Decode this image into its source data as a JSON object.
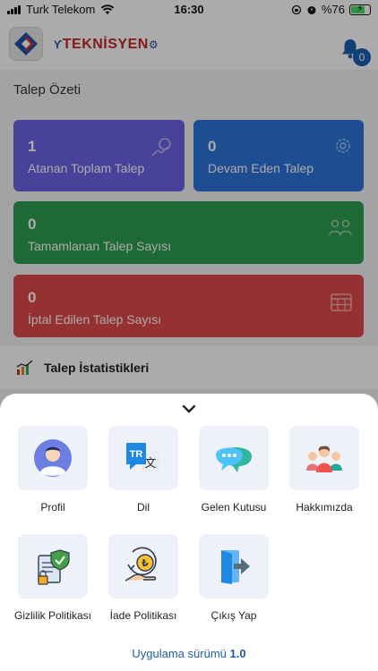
{
  "status_bar": {
    "carrier": "Turk Telekom",
    "time": "16:30",
    "battery": "%76",
    "battery_level": 0.76
  },
  "header": {
    "brand": "TEKNİSYEN",
    "notification_count": "0"
  },
  "summary": {
    "title": "Talep Özeti",
    "cards": [
      {
        "value": "1",
        "label": "Atanan Toplam Talep",
        "color": "#6c63e6"
      },
      {
        "value": "0",
        "label": "Devam Eden Talep",
        "color": "#2f73d8"
      },
      {
        "value": "0",
        "label": "Tamamlanan Talep Sayısı",
        "color": "#2e9e52"
      },
      {
        "value": "0",
        "label": "İptal Edilen Talep Sayısı",
        "color": "#e04949"
      }
    ]
  },
  "stats": {
    "title": "Talep İstatistikleri"
  },
  "menu": {
    "items": [
      {
        "label": "Profil",
        "icon": "user-avatar-icon"
      },
      {
        "label": "Dil",
        "icon": "translate-icon"
      },
      {
        "label": "Gelen Kutusu",
        "icon": "chat-bubble-icon"
      },
      {
        "label": "Hakkımızda",
        "icon": "team-icon"
      },
      {
        "label": "Gizlilik Politikası",
        "icon": "privacy-shield-icon"
      },
      {
        "label": "İade Politikası",
        "icon": "refund-coin-icon"
      },
      {
        "label": "Çıkış Yap",
        "icon": "logout-door-icon"
      }
    ],
    "version_label": "Uygulama sürümü",
    "version_number": "1.0"
  }
}
